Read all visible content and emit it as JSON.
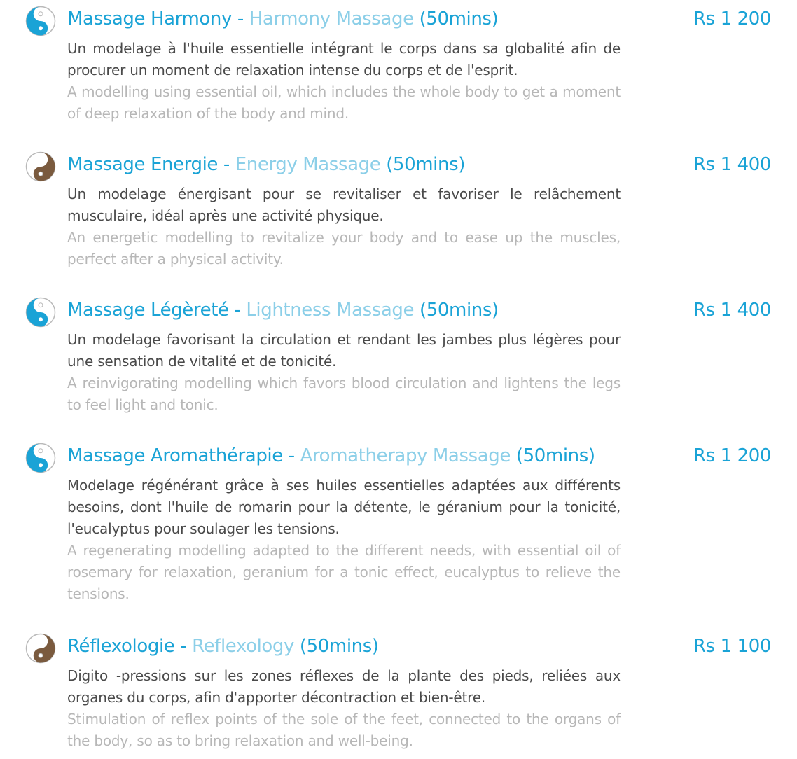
{
  "colors": {
    "blue": "#1aa3d6",
    "light_blue": "#8ccfe8",
    "fr_text": "#4a4a4a",
    "en_text": "#b7b7b7",
    "brown": "#7a5a3e"
  },
  "items": [
    {
      "icon": "yin-yang-blue-icon",
      "title_fr": "Massage Harmony",
      "separator": "-",
      "title_en": "Harmony Massage",
      "duration": "(50mins)",
      "price": "Rs 1 200",
      "desc_fr": "Un modelage à l'huile essentielle intégrant le corps dans sa globalité afin de procurer un moment de relaxation intense du corps et de l'esprit.",
      "desc_en": "A modelling using essential oil, which includes the whole body to get a moment of deep relaxation of the body and mind."
    },
    {
      "icon": "yin-yang-brown-icon",
      "title_fr": "Massage Energie",
      "separator": "-",
      "title_en": "Energy Massage",
      "duration": "(50mins)",
      "price": "Rs 1 400",
      "desc_fr": "Un modelage énergisant pour se revitaliser et favoriser le relâchement musculaire, idéal après une activité physique.",
      "desc_en": "An energetic modelling to revitalize your body and to ease up the muscles, perfect after a physical activity."
    },
    {
      "icon": "yin-yang-blue-icon",
      "title_fr": "Massage Légèreté",
      "separator": "-",
      "title_en": "Lightness Massage",
      "duration": "(50mins)",
      "price": "Rs 1 400",
      "desc_fr": "Un modelage favorisant la circulation et rendant les jambes plus légères pour une sensation de vitalité et de tonicité.",
      "desc_en": "A reinvigorating modelling which favors blood circulation and lightens the legs to feel light and tonic."
    },
    {
      "icon": "yin-yang-blue-icon",
      "title_fr": "Massage Aromathérapie",
      "separator": "-",
      "title_en": "Aromatherapy Massage",
      "duration": "(50mins)",
      "price": "Rs 1 200",
      "desc_fr": "Modelage régénérant grâce à ses huiles essentielles adaptées aux différents besoins, dont l'huile de romarin pour la détente, le géranium pour la tonicité, l'eucalyptus pour soulager les tensions.",
      "desc_en": "A regenerating modelling adapted to the different needs, with essential oil of rosemary for relaxation, geranium for a tonic effect, eucalyptus to relieve the tensions."
    },
    {
      "icon": "yin-yang-brown-icon",
      "title_fr": "Réflexologie",
      "separator": "-",
      "title_en": "Reflexology",
      "duration": "(50mins)",
      "price": "Rs 1 100",
      "desc_fr": "Digito -pressions sur les zones réflexes de la plante des pieds, reliées aux organes du corps, afin d'apporter décontraction et bien-être.",
      "desc_en": "Stimulation of reflex points of the sole of the feet, connected to the organs of the body, so as to bring relaxation and well-being."
    }
  ]
}
